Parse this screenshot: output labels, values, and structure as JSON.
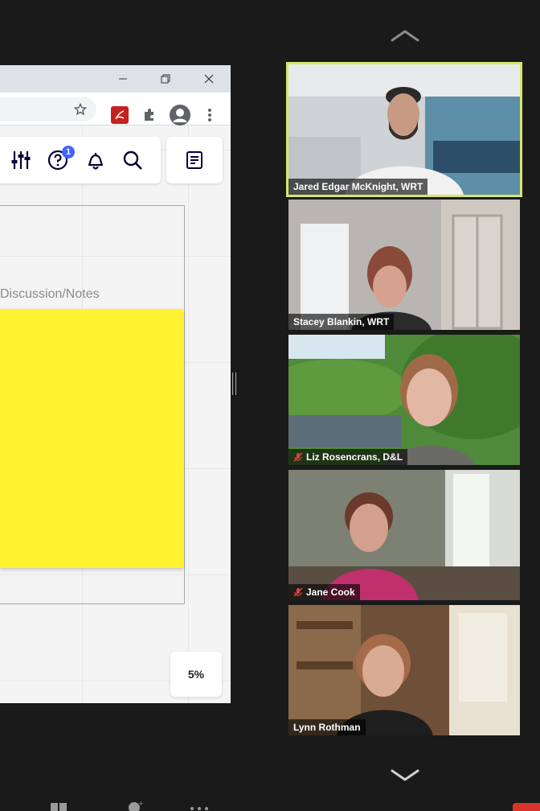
{
  "browser": {
    "window_controls": {
      "minimize": "—",
      "restore": "❐",
      "close": "✕"
    },
    "icons": [
      "star-icon",
      "pdf-extension-icon",
      "puzzle-extension-icon",
      "profile-icon",
      "kebab-menu-icon"
    ]
  },
  "whiteboard": {
    "toolbar_icons": [
      "sliders-icon",
      "help-icon",
      "bell-icon",
      "search-icon"
    ],
    "help_badge": "1",
    "frame_label": "Discussion/Notes",
    "sticky_color": "#fff230",
    "zoom": "5%"
  },
  "gallery": {
    "participants": [
      {
        "name": "Jared Edgar McKnight, WRT",
        "muted": false,
        "active": true
      },
      {
        "name": "Stacey Blankin, WRT",
        "muted": false,
        "active": false
      },
      {
        "name": "Liz Rosencrans, D&L",
        "muted": true,
        "active": false
      },
      {
        "name": "Jane Cook",
        "muted": true,
        "active": false
      },
      {
        "name": "Lynn Rothman",
        "muted": false,
        "active": false
      }
    ],
    "active_speaker_color": "#d8e56a"
  }
}
